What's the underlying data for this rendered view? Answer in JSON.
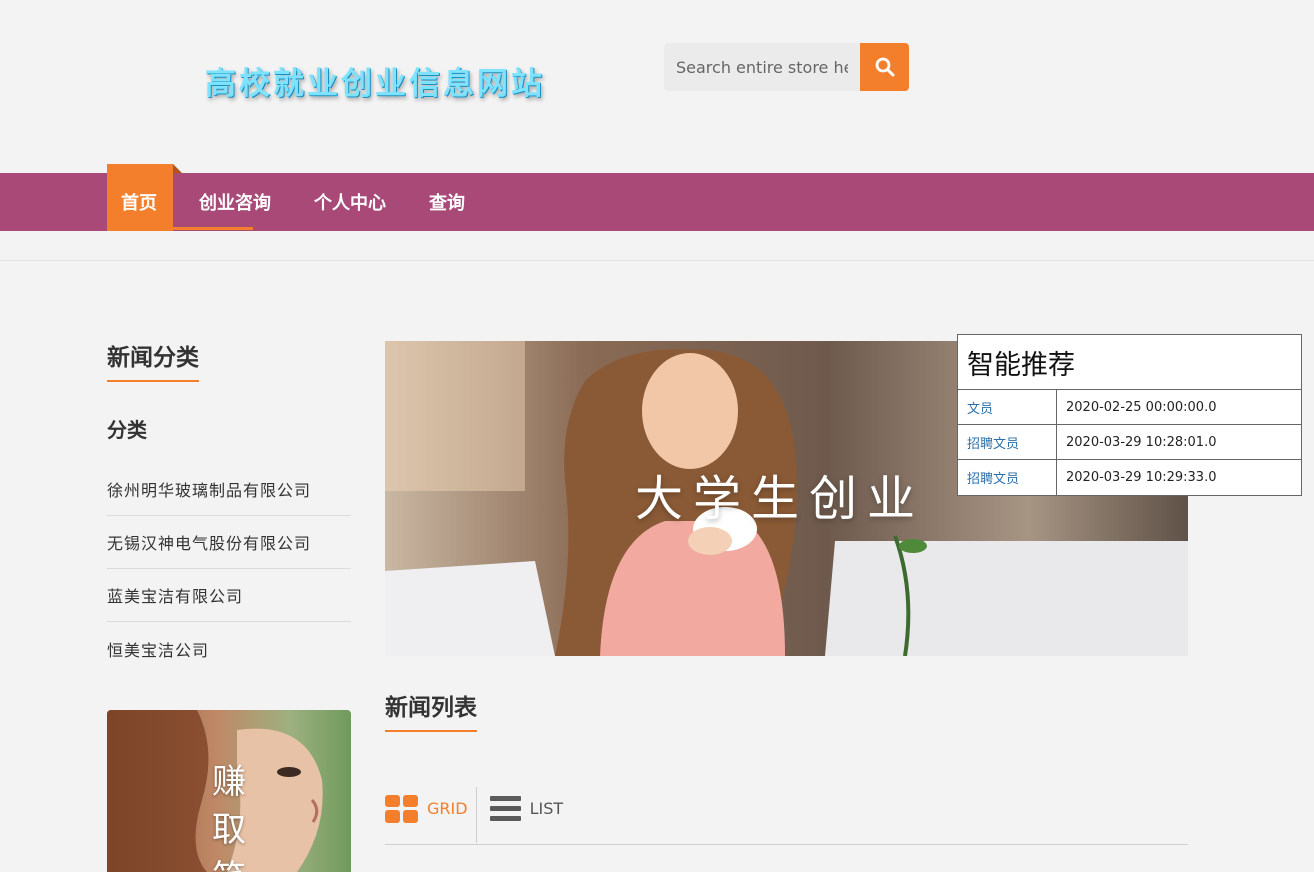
{
  "header": {
    "logo_text": "高校就业创业信息网站",
    "search": {
      "placeholder": "Search entire store here",
      "value": ""
    },
    "search_button_icon": "search-icon"
  },
  "nav": {
    "items": [
      {
        "label": "首页",
        "active": true
      },
      {
        "label": "创业咨询",
        "active": false
      },
      {
        "label": "个人中心",
        "active": false
      },
      {
        "label": "查询",
        "active": false
      }
    ],
    "active_color": "#f37f2c",
    "bar_color": "#a84977"
  },
  "sidebar": {
    "title": "新闻分类",
    "subtitle": "分类",
    "categories": [
      "徐州明华玻璃制品有限公司",
      "无锡汉神电气股份有限公司",
      "蓝美宝洁有限公司",
      "恒美宝洁公司"
    ],
    "ad_text": "赚取笑"
  },
  "banner": {
    "text": "大学生创业"
  },
  "news": {
    "title": "新闻列表",
    "view_grid_label": "GRID",
    "view_list_label": "LIST",
    "grid_icon": "grid-icon",
    "list_icon": "list-icon"
  },
  "recommend": {
    "title": "智能推荐",
    "rows": [
      {
        "name": "文员",
        "time": "2020-02-25 00:00:00.0"
      },
      {
        "name": "招聘文员",
        "time": "2020-03-29 10:28:01.0"
      },
      {
        "name": "招聘文员",
        "time": "2020-03-29 10:29:33.0"
      }
    ]
  }
}
